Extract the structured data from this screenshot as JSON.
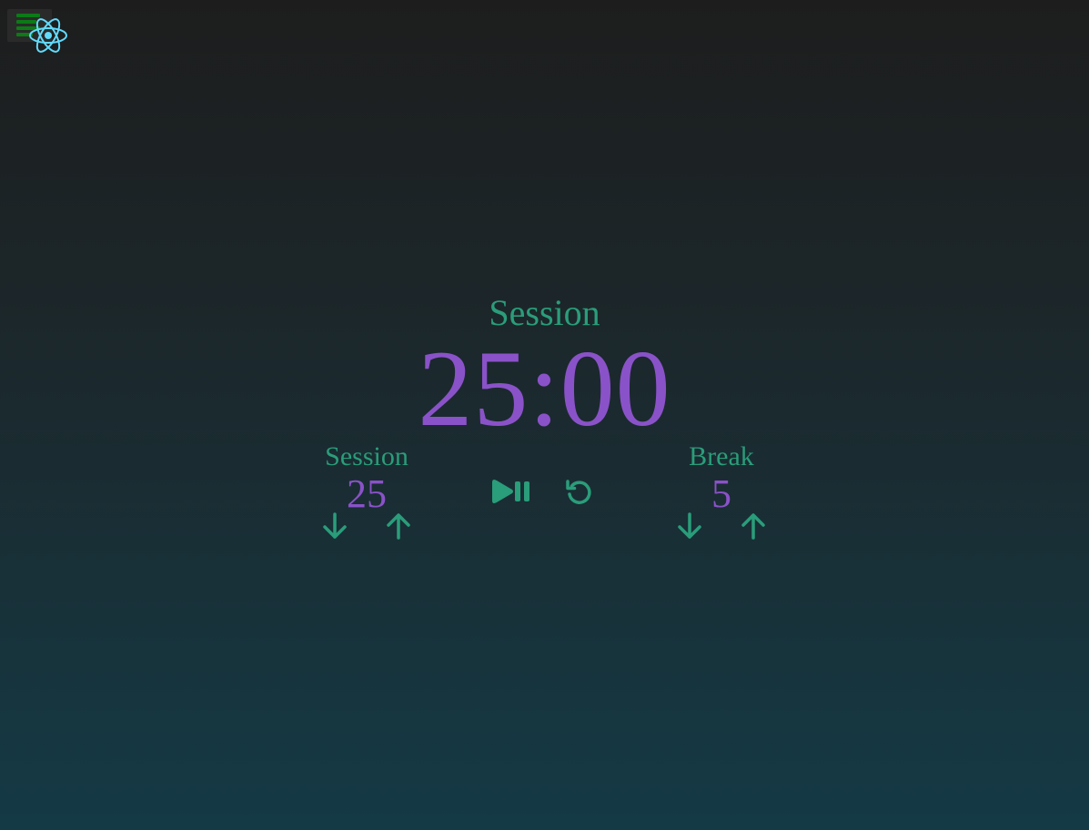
{
  "colors": {
    "accent_green": "#2a9d7a",
    "accent_purple": "#8a52c8",
    "react_blue": "#61dafb",
    "menu_green": "#0c7a16"
  },
  "overlay": {
    "menu_icon": "hamburger-icon",
    "logo_icon": "react-logo-icon"
  },
  "timer": {
    "label": "Session",
    "time": "25:00"
  },
  "session_length": {
    "label": "Session",
    "value": "25",
    "decrement_icon": "arrow-down-icon",
    "increment_icon": "arrow-up-icon"
  },
  "break_length": {
    "label": "Break",
    "value": "5",
    "decrement_icon": "arrow-down-icon",
    "increment_icon": "arrow-up-icon"
  },
  "controls": {
    "start_stop_icon": "play-pause-icon",
    "reset_icon": "reset-icon"
  }
}
